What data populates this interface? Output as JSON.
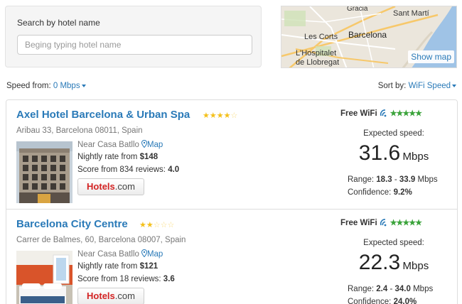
{
  "search": {
    "label": "Search by hotel name",
    "placeholder": "Beging typing hotel name",
    "value": ""
  },
  "map": {
    "labels": [
      "Gràcia",
      "Sant Martí",
      "Barcelona",
      "Les Corts",
      "L'Hospitalet",
      "de Llobregat"
    ],
    "show_map_label": "Show map"
  },
  "filters": {
    "speed_from_label": "Speed from:",
    "speed_from_value": "0 Mbps",
    "sort_by_label": "Sort by:",
    "sort_by_value": "WiFi Speed"
  },
  "colors": {
    "link": "#2a7ab8",
    "star": "#f4c01a",
    "wifi_green": "#3aa33a",
    "brand_red": "#d32323"
  },
  "hotels": [
    {
      "name": "Axel Hotel Barcelona & Urban Spa",
      "stars_filled": 4,
      "stars_total": 5,
      "address": "Aribau 33, Barcelona 08011, Spain",
      "near_text": "Near Casa Batllo",
      "map_link": "Map",
      "rate_label": "Nightly rate from ",
      "rate_value": "$148",
      "score_label": "Score from 834 reviews: ",
      "score_value": "4.0",
      "booking_brand_a": "Hotels",
      "booking_brand_b": ".com",
      "wifi_label": "Free WiFi",
      "wifi_rating": 5,
      "expected_label": "Expected speed:",
      "speed_value": "31.6",
      "speed_unit": "Mbps",
      "range_label": "Range: ",
      "range_low": "18.3",
      "range_sep": " - ",
      "range_high": "33.9",
      "range_unit": " Mbps",
      "confidence_label": "Confidence: ",
      "confidence_value": "9.2%"
    },
    {
      "name": "Barcelona City Centre",
      "stars_filled": 2,
      "stars_total": 5,
      "address": "Carrer de Balmes, 60, Barcelona 08007, Spain",
      "near_text": "Near Casa Batllo",
      "map_link": "Map",
      "rate_label": "Nightly rate from ",
      "rate_value": "$121",
      "score_label": "Score from 18 reviews: ",
      "score_value": "3.6",
      "booking_brand_a": "Hotels",
      "booking_brand_b": ".com",
      "wifi_label": "Free WiFi",
      "wifi_rating": 5,
      "expected_label": "Expected speed:",
      "speed_value": "22.3",
      "speed_unit": "Mbps",
      "range_label": "Range: ",
      "range_low": "2.4",
      "range_sep": " - ",
      "range_high": "34.0",
      "range_unit": " Mbps",
      "confidence_label": "Confidence: ",
      "confidence_value": "24.0%"
    }
  ]
}
